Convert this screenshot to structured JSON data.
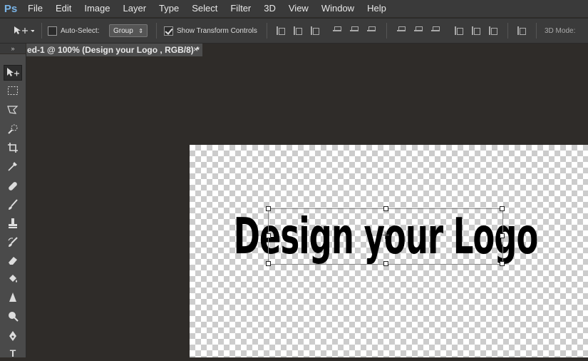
{
  "app": {
    "logo": "Ps"
  },
  "menu": [
    "File",
    "Edit",
    "Image",
    "Layer",
    "Type",
    "Select",
    "Filter",
    "3D",
    "View",
    "Window",
    "Help"
  ],
  "options": {
    "auto_select_label": "Auto-Select:",
    "auto_select_checked": false,
    "auto_select_mode": "Group",
    "show_transform_label": "Show Transform Controls",
    "show_transform_checked": true,
    "mode_3d_label": "3D Mode:"
  },
  "tool_header": "»",
  "document": {
    "tab_title": "ed-1 @ 100% (Design your Logo , RGB/8) *",
    "close_glyph": "×",
    "text_layer": "Design your Logo"
  },
  "tools": [
    {
      "name": "move-tool",
      "glyph": "▸"
    },
    {
      "name": "marquee-tool",
      "glyph": "⬚"
    },
    {
      "name": "lasso-tool",
      "glyph": "ᐁ"
    },
    {
      "name": "quick-selection-tool",
      "glyph": "✎"
    },
    {
      "name": "crop-tool",
      "glyph": "⌗"
    },
    {
      "name": "eyedropper-tool",
      "glyph": "⁄"
    },
    {
      "name": "healing-brush-tool",
      "glyph": "✚"
    },
    {
      "name": "brush-tool",
      "glyph": "∕"
    },
    {
      "name": "clone-stamp-tool",
      "glyph": "⊥"
    },
    {
      "name": "history-brush-tool",
      "glyph": "↯"
    },
    {
      "name": "eraser-tool",
      "glyph": "▱"
    },
    {
      "name": "paint-bucket-tool",
      "glyph": "◈"
    },
    {
      "name": "blur-tool",
      "glyph": "▲"
    },
    {
      "name": "dodge-tool",
      "glyph": "●"
    },
    {
      "name": "pen-tool",
      "glyph": "✒"
    },
    {
      "name": "type-tool",
      "glyph": "T"
    }
  ]
}
